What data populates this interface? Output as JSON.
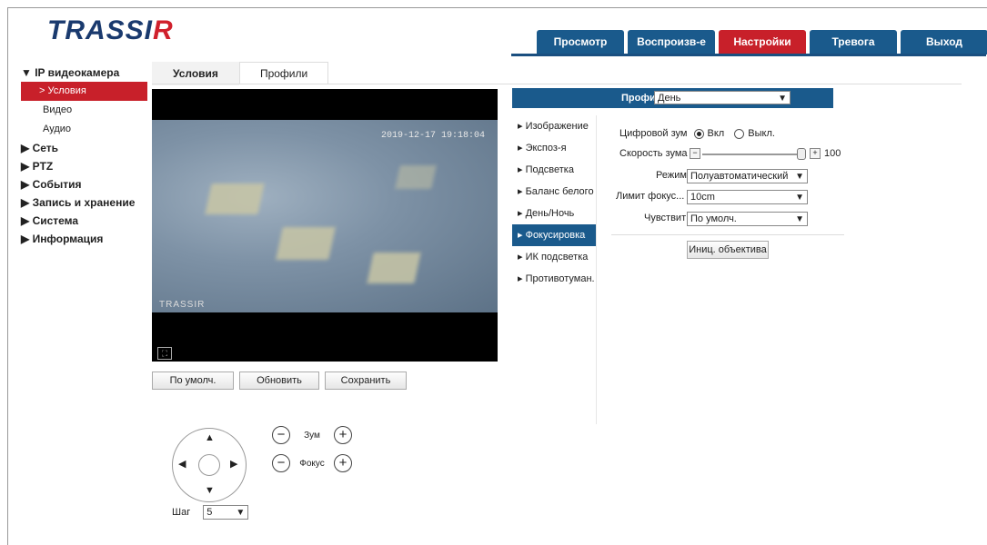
{
  "logo": {
    "part1": "TRASSI",
    "part2": "R"
  },
  "topnav": [
    {
      "label": "Просмотр",
      "active": false
    },
    {
      "label": "Воспроизв-е",
      "active": false
    },
    {
      "label": "Настройки",
      "active": true
    },
    {
      "label": "Тревога",
      "active": false
    },
    {
      "label": "Выход",
      "active": false
    }
  ],
  "sidebar": {
    "ipcam": "▼ IP видеокамера",
    "conditions": "> Условия",
    "video": "Видео",
    "audio": "Аудио",
    "network": "▶ Сеть",
    "ptz": "▶ PTZ",
    "events": "▶ События",
    "storage": "▶ Запись и хранение",
    "system": "▶ Система",
    "info": "▶ Информация"
  },
  "tabs": {
    "conditions": "Условия",
    "profiles": "Профили"
  },
  "video": {
    "timestamp": "2019-12-17 19:18:04",
    "watermark": "TRASSIR"
  },
  "buttons": {
    "default": "По умолч.",
    "refresh": "Обновить",
    "save": "Сохранить"
  },
  "ptz": {
    "zoom": "Зум",
    "focus": "Фокус",
    "step_label": "Шаг",
    "step_value": "5"
  },
  "profile": {
    "label": "Профиль",
    "value": "День"
  },
  "menu": [
    {
      "label": "▸ Изображение",
      "active": false
    },
    {
      "label": "▸ Экспоз-я",
      "active": false
    },
    {
      "label": "▸ Подсветка",
      "active": false
    },
    {
      "label": "▸ Баланс белого",
      "active": false
    },
    {
      "label": "▸ День/Ночь",
      "active": false
    },
    {
      "label": "▸ Фокусировка",
      "active": true
    },
    {
      "label": "▸ ИК подсветка",
      "active": false
    },
    {
      "label": "▸ Противотуман.",
      "active": false
    }
  ],
  "focus": {
    "digital_zoom_label": "Цифровой зум",
    "on_label": "Вкл",
    "off_label": "Выкл.",
    "zoom_speed_label": "Скорость зума",
    "zoom_speed_value": "100",
    "mode_label": "Режим",
    "mode_value": "Полуавтоматический",
    "focus_limit_label": "Лимит фокус...",
    "focus_limit_value": "10cm",
    "sensitivity_label": "Чувствит",
    "sensitivity_value": "По умолч.",
    "lens_init_button": "Иниц. объектива"
  },
  "colors": {
    "nav_blue": "#1a5a8c",
    "accent_red": "#c8202a"
  }
}
